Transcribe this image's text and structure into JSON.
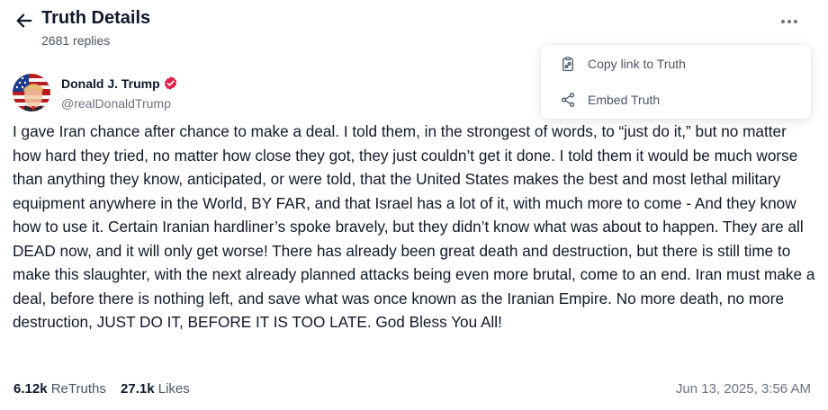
{
  "header": {
    "title": "Truth Details",
    "replies": "2681 replies"
  },
  "menu": {
    "items": [
      {
        "label": "Copy link to Truth",
        "icon": "clipboard-icon"
      },
      {
        "label": "Embed Truth",
        "icon": "share-nodes-icon"
      }
    ]
  },
  "post": {
    "author_name": "Donald J. Trump",
    "handle": "@realDonaldTrump",
    "verified_color": "#e11d48",
    "text": "I gave Iran chance after chance to make a deal. I told them, in the strongest of words, to “just do it,” but no matter how hard they tried, no matter how close they got, they just couldn’t get it done. I told them it would be much worse than anything they know, anticipated, or were told, that the United States makes the best and most lethal military equipment anywhere in the World, BY FAR, and that Israel has a lot of it, with much more to come - And they know how to use it. Certain Iranian hardliner’s spoke bravely, but they didn’t know what was about to happen. They are all DEAD now, and it will only get worse! There has already been great death and destruction, but there is still time to make this slaughter, with the next already planned attacks being even more brutal, come to an end. Iran must make a deal, before there is nothing left, and save what was once known as the Iranian Empire. No more death, no more destruction, JUST DO IT, BEFORE IT IS TOO LATE. God Bless You All!",
    "retruths_count": "6.12k",
    "retruths_label": "ReTruths",
    "likes_count": "27.1k",
    "likes_label": "Likes",
    "timestamp": "Jun 13, 2025, 3:56 AM"
  }
}
